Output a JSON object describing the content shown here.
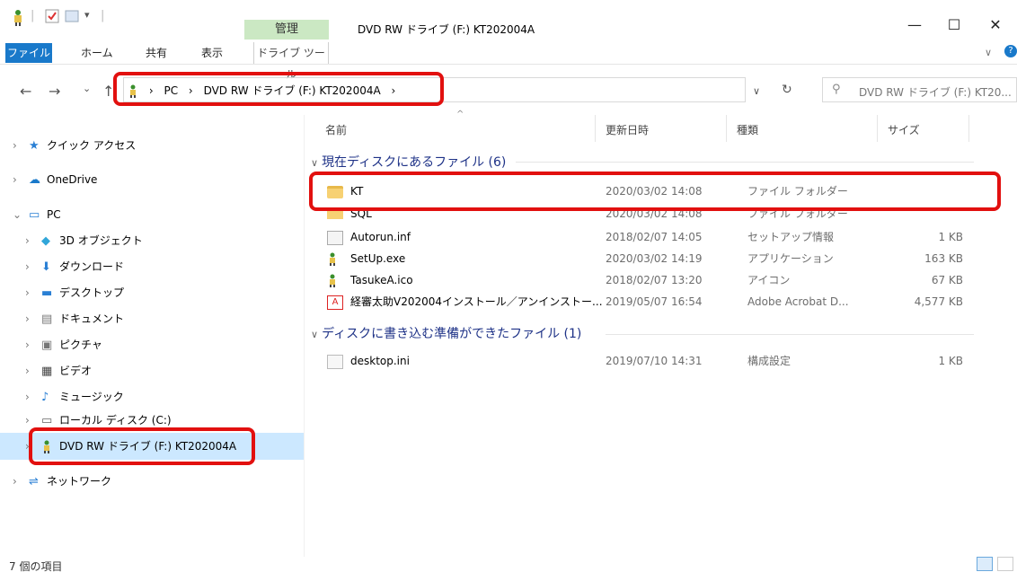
{
  "window": {
    "title": "DVD RW ドライブ (F:) KT202004A",
    "manage_tab": "管理",
    "controls": {
      "minimize": "—",
      "maximize": "☐",
      "close": "✕"
    }
  },
  "ribbon": {
    "tabs": [
      "ファイル",
      "ホーム",
      "共有",
      "表示"
    ],
    "drive_tools": "ドライブ ツール"
  },
  "address": {
    "segments": [
      "PC",
      "DVD RW ドライブ (F:) KT202004A"
    ],
    "separator": "›",
    "search_placeholder": "DVD RW ドライブ (F:) KT20..."
  },
  "nav": {
    "items": [
      {
        "label": "クイック アクセス",
        "icon": "star-icon",
        "chev": "›"
      },
      {
        "label": "OneDrive",
        "icon": "cloud-icon",
        "chev": "›"
      },
      {
        "label": "PC",
        "icon": "pc-icon",
        "chev": "⌄"
      },
      {
        "label": "3D オブジェクト",
        "icon": "cube-icon",
        "chev": "›"
      },
      {
        "label": "ダウンロード",
        "icon": "download-icon",
        "chev": "›"
      },
      {
        "label": "デスクトップ",
        "icon": "desktop-icon",
        "chev": "›"
      },
      {
        "label": "ドキュメント",
        "icon": "document-icon",
        "chev": "›"
      },
      {
        "label": "ピクチャ",
        "icon": "picture-icon",
        "chev": "›"
      },
      {
        "label": "ビデオ",
        "icon": "video-icon",
        "chev": "›"
      },
      {
        "label": "ミュージック",
        "icon": "music-icon",
        "chev": "›"
      },
      {
        "label": "ローカル ディスク (C:)",
        "icon": "disk-icon",
        "chev": "›"
      },
      {
        "label": "DVD RW ドライブ (F:) KT202004A",
        "icon": "dvd-drive-icon",
        "chev": "›"
      },
      {
        "label": "ネットワーク",
        "icon": "network-icon",
        "chev": "›"
      }
    ]
  },
  "columns": {
    "name": "名前",
    "date": "更新日時",
    "type": "種類",
    "size": "サイズ"
  },
  "groups": [
    {
      "title": "現在ディスクにあるファイル (6)",
      "files": [
        {
          "name": "KT",
          "date": "2020/03/02 14:08",
          "type": "ファイル フォルダー",
          "size": "",
          "icon": "folder-icon"
        },
        {
          "name": "SQL",
          "date": "2020/03/02 14:08",
          "type": "ファイル フォルダー",
          "size": "",
          "icon": "folder-icon"
        },
        {
          "name": "Autorun.inf",
          "date": "2018/02/07 14:05",
          "type": "セットアップ情報",
          "size": "1 KB",
          "icon": "setup-file-icon"
        },
        {
          "name": "SetUp.exe",
          "date": "2020/03/02 14:19",
          "type": "アプリケーション",
          "size": "163 KB",
          "icon": "app-icon"
        },
        {
          "name": "TasukeA.ico",
          "date": "2018/02/07 13:20",
          "type": "アイコン",
          "size": "67 KB",
          "icon": "ico-file-icon"
        },
        {
          "name": "経審太助V202004インストール／アンインストー...",
          "date": "2019/05/07 16:54",
          "type": "Adobe Acrobat D...",
          "size": "4,577 KB",
          "icon": "pdf-icon"
        }
      ]
    },
    {
      "title": "ディスクに書き込む準備ができたファイル (1)",
      "files": [
        {
          "name": "desktop.ini",
          "date": "2019/07/10 14:31",
          "type": "構成設定",
          "size": "1 KB",
          "icon": "config-file-icon"
        }
      ]
    }
  ],
  "status": {
    "count": "7 個の項目"
  },
  "colors": {
    "highlight": "#e2100f",
    "selection": "#cce8ff",
    "group_text": "#1e3287",
    "file_tab": "#1979ca",
    "manage_tab": "#cbe8c3"
  }
}
